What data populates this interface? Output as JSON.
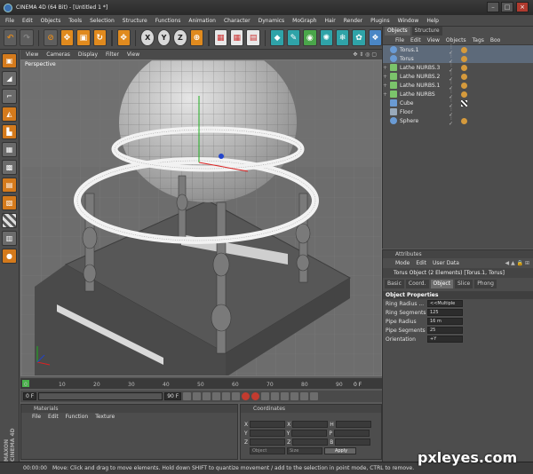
{
  "window": {
    "title": "CINEMA 4D (64 Bit) - [Untitled 1 *]"
  },
  "menubar": [
    "File",
    "Edit",
    "Objects",
    "Tools",
    "Selection",
    "Structure",
    "Functions",
    "Animation",
    "Character",
    "Dynamics",
    "MoGraph",
    "Hair",
    "Render",
    "Plugins",
    "Window",
    "Help"
  ],
  "viewport": {
    "menu": [
      "View",
      "Cameras",
      "Display",
      "Filter",
      "View"
    ],
    "label": "Perspective"
  },
  "timeline": {
    "ticks": [
      "0",
      "10",
      "20",
      "30",
      "40",
      "50",
      "60",
      "70",
      "80",
      "90"
    ],
    "frame": "0 F",
    "start": "0 F",
    "end": "90 F"
  },
  "objects_panel": {
    "tabs": [
      "Objects",
      "Structure"
    ],
    "menu": [
      "File",
      "Edit",
      "View",
      "Objects",
      "Tags",
      "Boo"
    ],
    "items": [
      {
        "name": "Torus.1",
        "type": "torus",
        "tag": "phong"
      },
      {
        "name": "Torus",
        "type": "torus",
        "tag": "phong"
      },
      {
        "name": "Lathe NURBS.3",
        "type": "lathe",
        "tag": "phong"
      },
      {
        "name": "Lathe NURBS.2",
        "type": "lathe",
        "tag": "phong"
      },
      {
        "name": "Lathe NURBS.1",
        "type": "lathe",
        "tag": "phong"
      },
      {
        "name": "Lathe NURBS",
        "type": "lathe",
        "tag": "phong"
      },
      {
        "name": "Cube",
        "type": "cube",
        "tag": "checker"
      },
      {
        "name": "Floor",
        "type": "floor",
        "tag": ""
      },
      {
        "name": "Sphere",
        "type": "sphere",
        "tag": "phong"
      }
    ]
  },
  "attributes_panel": {
    "title": "Attributes",
    "menu": [
      "Mode",
      "Edit",
      "User Data"
    ],
    "object_line": "Torus Object (2 Elements) [Torus.1, Torus]",
    "tabs": [
      "Basic",
      "Coord.",
      "Object",
      "Slice",
      "Phong"
    ],
    "section": "Object Properties",
    "properties": [
      {
        "label": "Ring Radius ...",
        "value": "<<Multiple"
      },
      {
        "label": "Ring Segments",
        "value": "125"
      },
      {
        "label": "Pipe Radius",
        "value": "16 m"
      },
      {
        "label": "Pipe Segments",
        "value": "25"
      },
      {
        "label": "Orientation",
        "value": "+Y"
      }
    ]
  },
  "materials_panel": {
    "title": "Materials",
    "menu": [
      "File",
      "Edit",
      "Function",
      "Texture"
    ]
  },
  "coordinates_panel": {
    "title": "Coordinates",
    "rows": [
      {
        "a": "X",
        "b": "X",
        "c": "H"
      },
      {
        "a": "Y",
        "b": "Y",
        "c": "P"
      },
      {
        "a": "Z",
        "b": "Z",
        "c": "B"
      }
    ],
    "mode1": "Object",
    "mode2": "Size",
    "apply": "Apply"
  },
  "statusbar": {
    "time": "00:00:00",
    "message": "Move: Click and drag to move elements. Hold down SHIFT to quantize movement / add to the selection in point mode, CTRL to remove."
  },
  "brand": "MAXON CINEMA 4D",
  "watermark": "pxleyes.com",
  "colors": {
    "accent_orange": "#e08a1e",
    "selected_blue": "#5d6a7a"
  }
}
